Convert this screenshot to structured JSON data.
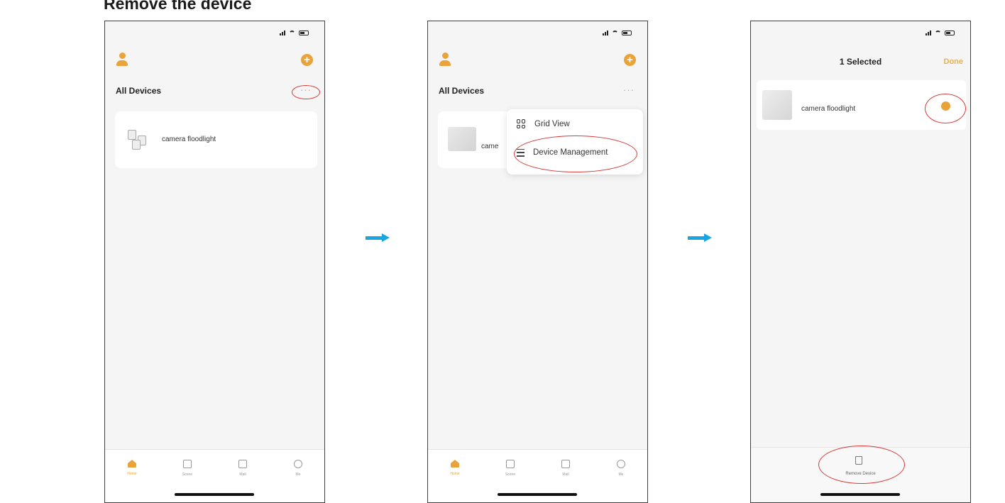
{
  "heading": "Remove the device",
  "accent_color": "#e8a33b",
  "highlight_color": "#d63a3a",
  "arrow_color": "#19a6e0",
  "screen1": {
    "section_title": "All Devices",
    "more_label": "···",
    "device_name": "camera floodlight",
    "tabs": [
      "Home",
      "Scene",
      "Mall",
      "Me"
    ]
  },
  "screen2": {
    "section_title": "All Devices",
    "more_label": "···",
    "device_name_partial": "came",
    "menu": {
      "grid_view": "Grid View",
      "device_management": "Device Management"
    },
    "tabs": [
      "Home",
      "Scene",
      "Mall",
      "Me"
    ]
  },
  "screen3": {
    "nav_title": "1 Selected",
    "done_label": "Done",
    "device_name": "camera floodlight",
    "remove_label": "Remove Device"
  }
}
